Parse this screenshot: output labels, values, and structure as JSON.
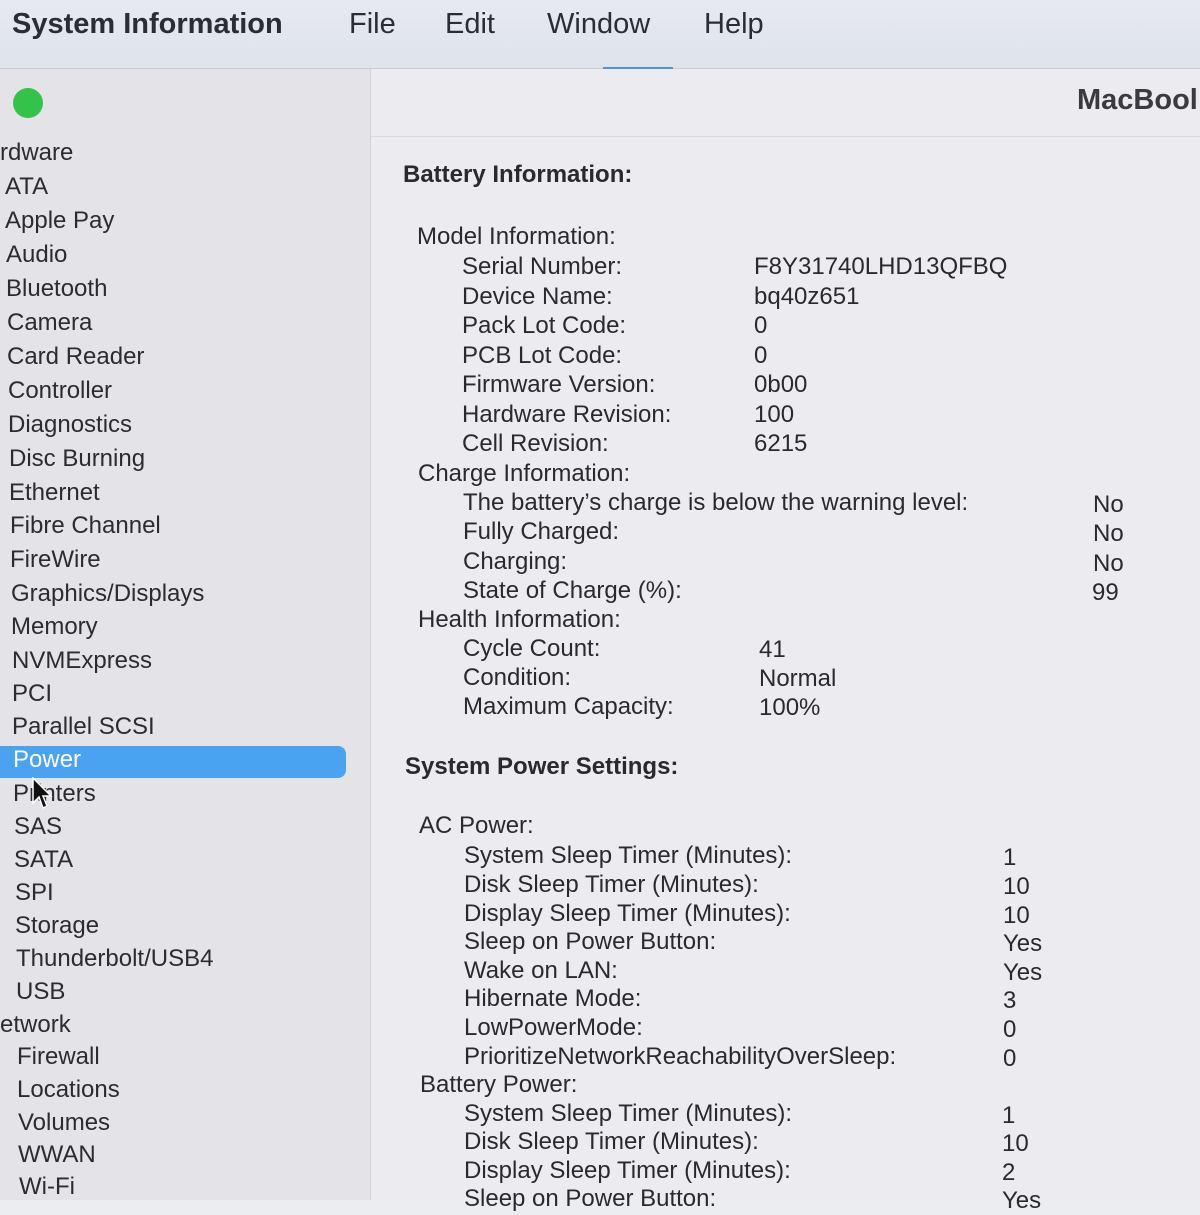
{
  "menubar": {
    "app_name": "System Information",
    "items": [
      "File",
      "Edit",
      "Window",
      "Help"
    ]
  },
  "window": {
    "title_partial": "MacBool"
  },
  "sidebar": {
    "hardware_label": "rdware",
    "hardware_items": [
      "ATA",
      "Apple Pay",
      "Audio",
      "Bluetooth",
      "Camera",
      "Card Reader",
      "Controller",
      "Diagnostics",
      "Disc Burning",
      "Ethernet",
      "Fibre Channel",
      "FireWire",
      "Graphics/Displays",
      "Memory",
      "NVMExpress",
      "PCI",
      "Parallel SCSI",
      "Power",
      "Printers",
      "SAS",
      "SATA",
      "SPI",
      "Storage",
      "Thunderbolt/USB4",
      "USB"
    ],
    "selected": "Power",
    "network_label": "etwork",
    "network_items": [
      "Firewall",
      "Locations",
      "Volumes",
      "WWAN",
      "Wi-Fi"
    ]
  },
  "battery": {
    "heading": "Battery Information:",
    "model": {
      "label": "Model Information:",
      "rows": [
        {
          "k": "Serial Number:",
          "v": "F8Y31740LHD13QFBQ"
        },
        {
          "k": "Device Name:",
          "v": "bq40z651"
        },
        {
          "k": "Pack Lot Code:",
          "v": "0"
        },
        {
          "k": "PCB Lot Code:",
          "v": "0"
        },
        {
          "k": "Firmware Version:",
          "v": "0b00"
        },
        {
          "k": "Hardware Revision:",
          "v": "100"
        },
        {
          "k": "Cell Revision:",
          "v": "6215"
        }
      ]
    },
    "charge": {
      "label": "Charge Information:",
      "rows": [
        {
          "k": "The battery’s charge is below the warning level:",
          "v": "No"
        },
        {
          "k": "Fully Charged:",
          "v": "No"
        },
        {
          "k": "Charging:",
          "v": "No"
        },
        {
          "k": "State of Charge (%):",
          "v": "99"
        }
      ]
    },
    "health": {
      "label": "Health Information:",
      "rows": [
        {
          "k": "Cycle Count:",
          "v": "41"
        },
        {
          "k": "Condition:",
          "v": "Normal"
        },
        {
          "k": "Maximum Capacity:",
          "v": "100%"
        }
      ]
    }
  },
  "power": {
    "heading": "System Power Settings:",
    "ac": {
      "label": "AC Power:",
      "rows": [
        {
          "k": "System Sleep Timer (Minutes):",
          "v": "1"
        },
        {
          "k": "Disk Sleep Timer (Minutes):",
          "v": "10"
        },
        {
          "k": "Display Sleep Timer (Minutes):",
          "v": "10"
        },
        {
          "k": "Sleep on Power Button:",
          "v": "Yes"
        },
        {
          "k": "Wake on LAN:",
          "v": "Yes"
        },
        {
          "k": "Hibernate Mode:",
          "v": "3"
        },
        {
          "k": "LowPowerMode:",
          "v": "0"
        },
        {
          "k": "PrioritizeNetworkReachabilityOverSleep:",
          "v": "0"
        }
      ]
    },
    "battery_power": {
      "label": "Battery Power:",
      "rows": [
        {
          "k": "System Sleep Timer (Minutes):",
          "v": "1"
        },
        {
          "k": "Disk Sleep Timer (Minutes):",
          "v": "10"
        },
        {
          "k": "Display Sleep Timer (Minutes):",
          "v": "2"
        },
        {
          "k": "Sleep on Power Button:",
          "v": "Yes"
        }
      ]
    }
  },
  "colors": {
    "selection": "#4aa2f0",
    "traffic_green": "#35c24a"
  }
}
